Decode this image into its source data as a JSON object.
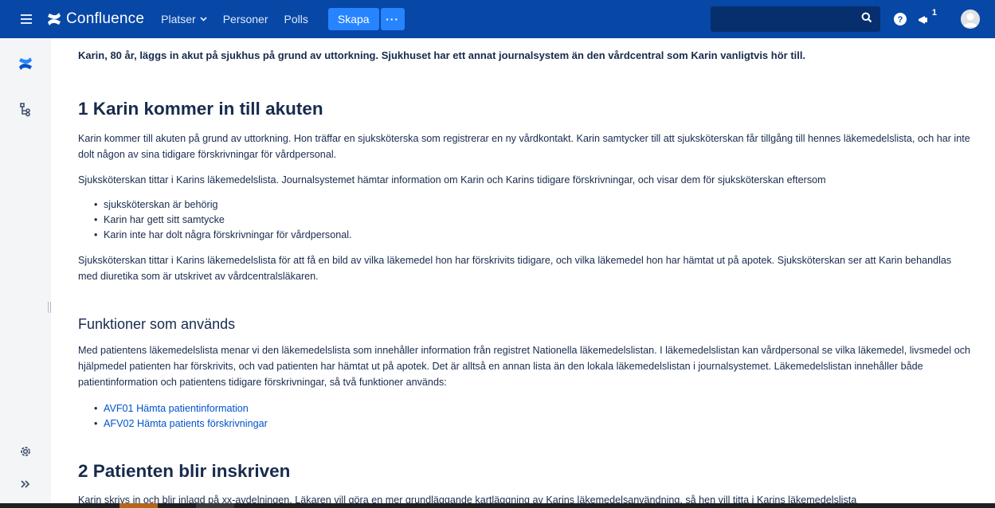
{
  "topbar": {
    "menu_icon": "hamburger-icon",
    "logo_text": "Confluence",
    "nav": [
      {
        "label": "Platser",
        "has_dropdown": true
      },
      {
        "label": "Personer"
      },
      {
        "label": "Polls"
      }
    ],
    "create_label": "Skapa",
    "more_label": "···",
    "search_placeholder": "",
    "notification_count": "1",
    "accent_color": "#0747a6",
    "button_color": "#2684ff"
  },
  "sidebar": {
    "icons": [
      "confluence-logo-icon",
      "page-tree-icon",
      "settings-icon",
      "expand-icon"
    ]
  },
  "page": {
    "intro": "Karin, 80 år, läggs in akut på sjukhus på grund av uttorkning. Sjukhuset har ett annat journalsystem än den vårdcentral som Karin vanligtvis hör till.",
    "section1": {
      "heading": "1 Karin kommer in till akuten",
      "p1": "Karin kommer till akuten på grund av uttorkning. Hon träffar en sjuksköterska som registrerar en ny vårdkontakt. Karin samtycker till att sjuksköterskan får tillgång till hennes läkemedelslista, och har inte dolt någon av sina tidigare förskrivningar för vårdpersonal.",
      "p2": "Sjuksköterskan tittar i Karins läkemedelslista. Journalsystemet hämtar information om Karin och Karins tidigare förskrivningar, och visar dem för sjuksköterskan eftersom",
      "bullets": [
        "sjuksköterskan är behörig",
        "Karin har gett sitt samtycke",
        "Karin inte har dolt några förskrivningar för vårdpersonal."
      ],
      "p3": "Sjuksköterskan tittar i Karins läkemedelslista för att få en bild av vilka läkemedel hon har förskrivits tidigare, och vilka läkemedel hon har hämtat ut på apotek. Sjuksköterskan ser att Karin behandlas med diuretika som är utskrivet av vårdcentralsläkaren."
    },
    "functions": {
      "heading": "Funktioner som används",
      "p1": "Med patientens läkemedelslista menar vi den läkemedelslista som innehåller information från registret Nationella läkemedelslistan. I läkemedelslistan kan vårdpersonal se vilka läkemedel, livsmedel och hjälpmedel patienten har förskrivits, och vad patienten har hämtat ut på apotek. Det är alltså en annan lista än den lokala läkemedelslistan i journalsystemet. Läkemedelslistan innehåller både patientinformation och patientens tidigare förskrivningar, så två funktioner används:",
      "links": [
        "AVF01 Hämta patientinformation",
        "AFV02 Hämta patients förskrivningar"
      ]
    },
    "section2": {
      "heading": "2 Patienten blir inskriven",
      "p1": "Karin skrivs in och blir inlagd på xx-avdelningen. Läkaren vill göra en mer grundläggande kartläggning av Karins läkemedelsanvändning, så hen vill titta i Karins läkemedelslista"
    }
  }
}
